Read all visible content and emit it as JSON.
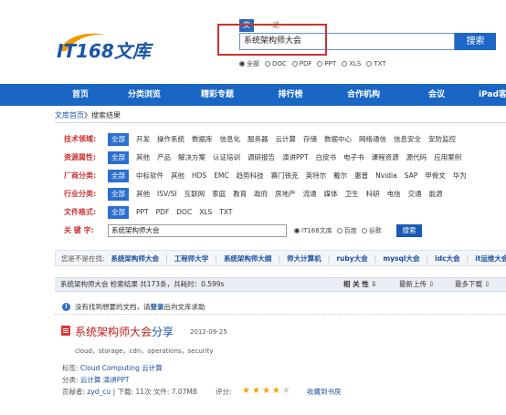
{
  "brand": {
    "logo_text": "IT168文库",
    "colors": {
      "primary": "#1a66c4",
      "accent_red": "#c8342e",
      "logo_orange": "#f39800"
    }
  },
  "search": {
    "tabs": [
      "文档",
      "论坛"
    ],
    "query": "系统架构师大会",
    "button": "搜索",
    "filetypes": [
      "全部",
      "DOC",
      "PDF",
      "PPT",
      "XLS",
      "TXT"
    ],
    "selected_filetype": "全部"
  },
  "nav": {
    "items": [
      "首页",
      "分类浏览",
      "精彩专题",
      "排行榜",
      "合作机构",
      "会议",
      "iPad客户"
    ]
  },
  "breadcrumb": {
    "home": "文库首页",
    "sep": "》",
    "current": "搜索结果"
  },
  "filters": [
    {
      "label": "技术领域:",
      "options": [
        "全部",
        "开发",
        "操作系统",
        "数据库",
        "信息化",
        "服务器",
        "云计算",
        "存储",
        "数据中心",
        "网络通信",
        "信息安全",
        "安防监控",
        "移"
      ]
    },
    {
      "label": "资源属性:",
      "options": [
        "全部",
        "其他",
        "产品",
        "解决方案",
        "认证培训",
        "调研报告",
        "演讲PPT",
        "白皮书",
        "电子书",
        "课程资源",
        "源代码",
        "应用案例"
      ]
    },
    {
      "label": "厂商分类:",
      "options": [
        "全部",
        "中标软件",
        "其他",
        "HDS",
        "EMC",
        "趋势科技",
        "赛门铁克",
        "英特尔",
        "戴尔",
        "惠普",
        "Nvidia",
        "SAP",
        "甲骨文",
        "华为",
        "I"
      ]
    },
    {
      "label": "行业分类:",
      "options": [
        "全部",
        "其他",
        "ISV/SI",
        "互联网",
        "家庭",
        "教育",
        "政府",
        "房地产",
        "流通",
        "媒体",
        "卫生",
        "科研",
        "电信",
        "交通",
        "能源",
        "制造"
      ]
    },
    {
      "label": "文件格式:",
      "options": [
        "全部",
        "PPT",
        "PDF",
        "DOC",
        "XLS",
        "TXT"
      ]
    }
  ],
  "keyword": {
    "label": "关 键 字:",
    "value": "系统架构师大会",
    "engines": [
      "IT168文库",
      "百度",
      "谷歌"
    ],
    "selected_engine": "IT168文库",
    "button": "搜索"
  },
  "related": {
    "label": "您是不是在找:",
    "items": [
      "系统架构师大会",
      "工程师大学",
      "系统架构师大纲",
      "师大计算机",
      "ruby大会",
      "mysql大会",
      "idc大会",
      "it运维大会"
    ]
  },
  "results_bar": {
    "info": "系统架构师大会 检索结果 共173条，共耗时：0.599s",
    "sort": [
      "相 关 性 ⇩",
      "最新上传 ⇩",
      "最多下载 ⇩"
    ]
  },
  "notice": {
    "prefix": "没有找到想要的文档，请",
    "login": "登录",
    "suffix": "后向文库求助"
  },
  "result": {
    "title": "系统架构师大会",
    "title_suffix": "分享",
    "date": "2012-09-25",
    "description": "cloud，storage，cdn，operations，security",
    "tags_label": "标签:",
    "tags": "Cloud Computing  云计算",
    "category_label": "分类:",
    "category": "云计算 演讲PPT",
    "contributor_label": "贡献者:",
    "contributor": "zyd_cu",
    "downloads": "| 下载: 11次  文件: 7.07MB",
    "rating_label": "评分:",
    "rating": 4,
    "rating_max": 5,
    "bookmark": "收藏到书房"
  }
}
